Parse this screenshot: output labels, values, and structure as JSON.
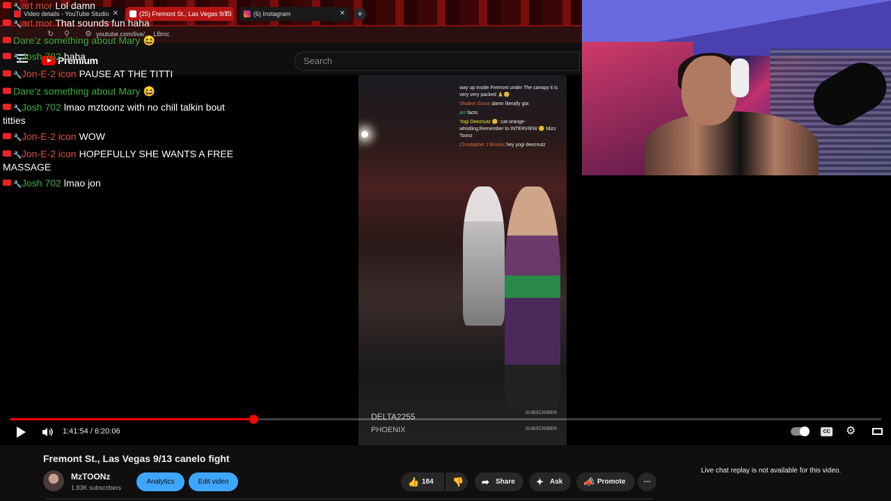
{
  "browser": {
    "tabs": [
      {
        "label": "Video details - YouTube Studio"
      },
      {
        "label": "(25) Fremont St., Las Vegas 9/13"
      },
      {
        "label": "(6) Instagram"
      }
    ],
    "new_tab": "+",
    "url": "youtube.com/live/..._LBmc"
  },
  "header": {
    "logo_text": "Premium",
    "search_placeholder": "Search"
  },
  "chat": [
    {
      "name": "art mor",
      "color": "red",
      "text": "Lol damn"
    },
    {
      "name": "art mor",
      "color": "red",
      "text": "That sounds fun haha"
    },
    {
      "name": "Dare'z something about Mary",
      "color": "green",
      "text": "😆"
    },
    {
      "name": "Josh 702",
      "color": "green",
      "text": "haha"
    },
    {
      "name": "Jon-E-2 icon",
      "color": "red",
      "text": "PAUSE AT THE TITTI"
    },
    {
      "name": "Dare'z something about Mary",
      "color": "green",
      "text": "😆"
    },
    {
      "name": "Josh 702",
      "color": "green",
      "text": "lmao mztoonz with no chill talkin bout titties"
    },
    {
      "name": "Jon-E-2 icon",
      "color": "red",
      "text": "WOW"
    },
    {
      "name": "Jon-E-2 icon",
      "color": "red",
      "text": "HOPEFULLY SHE WANTS A FREE MASSAGE"
    },
    {
      "name": "Josh 702",
      "color": "green",
      "text": "lmao jon"
    }
  ],
  "video": {
    "inset_chat": [
      {
        "name": "",
        "text": "way up inside Fremont under The canopy it is very very packed 🙏😊"
      },
      {
        "name": "Shalem Gross",
        "text": "damn literally gta"
      },
      {
        "name": "airi",
        "text": "facts"
      },
      {
        "name": "Yogi Deeznutz",
        "text": "😊 :cat-orange-whistling:Remember to INTERVIEW 😊 Mizz Toonz"
      },
      {
        "name": "Christopher J Brooks",
        "text": "hey yogi deeznutz"
      }
    ],
    "watermark_1": "DELTA2255",
    "watermark_2": "PHOENIX",
    "watermark_sub": "SUBSCRIBER"
  },
  "player": {
    "time": "1:41:54 / 6:20:06",
    "progress_fraction": 0.2797,
    "cc_label": "CC"
  },
  "details": {
    "title": "Fremont St., Las Vegas 9/13 canelo fight",
    "channel": "MzTOONz",
    "subscribers": "1.83K subscribers",
    "analytics": "Analytics",
    "edit": "Edit video",
    "likes": "184",
    "share": "Share",
    "ask": "Ask",
    "promote": "Promote",
    "more": "⋯",
    "live_chat_note": "Live chat replay is not available for this video."
  },
  "colors": {
    "accent_red": "#ff0000",
    "button_blue": "#3ea6ff",
    "chat_red": "#e0503a",
    "chat_green": "#3bb03b"
  }
}
